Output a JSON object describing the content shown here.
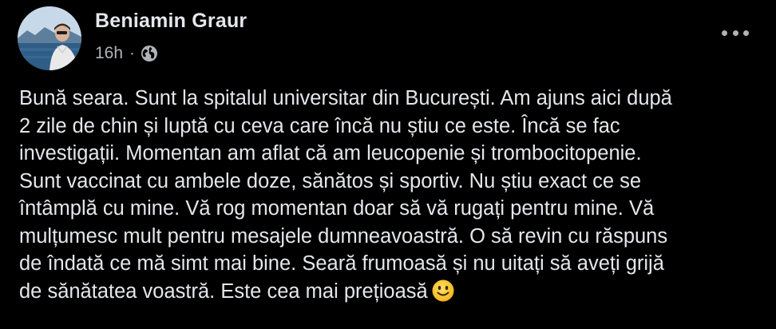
{
  "post": {
    "author": "Beniamin Graur",
    "time": "16h",
    "separator": "·",
    "privacy_icon": "globe-icon",
    "more_icon": "more-options-icon",
    "text": "Bună seara. Sunt la spitalul universitar din București. Am ajuns aici după\n2 zile de chin și luptă cu ceva care încă nu știu ce este. Încă se fac\ninvestigații. Momentan am aflat că am leucopenie și trombocitopenie.\nSunt vaccinat cu ambele doze, sănătos și sportiv. Nu știu exact ce se\nîntâmplă cu mine. Vă rog momentan doar să vă rugați pentru mine. Vă\nmulțumesc mult pentru mesajele dumneavoastră. O să revin cu răspuns\nde îndată ce mă simt mai bine. Seară frumoasă și nu uitați să aveți grijă\nde sănătatea voastră. Este cea mai prețioasă",
    "emoji": "slightly-smiling-face-emoji"
  },
  "colors": {
    "background": "#000000",
    "primary_text": "#e4e6eb",
    "secondary_text": "#b0b3b8",
    "emoji_yellow": "#f7c325"
  }
}
